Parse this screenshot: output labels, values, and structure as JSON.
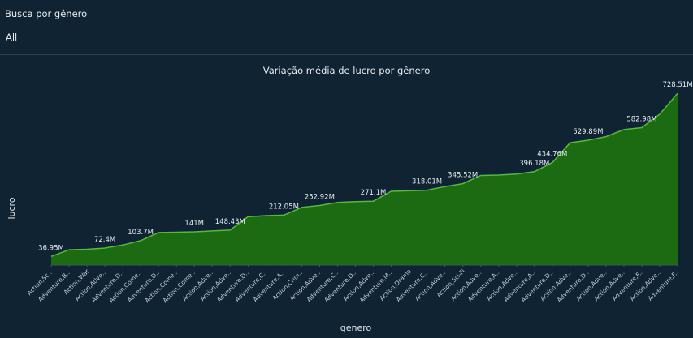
{
  "filter": {
    "label": "Busca por gênero",
    "value": "All"
  },
  "chart_data": {
    "type": "area",
    "title": "Variação média de lucro por gênero",
    "xlabel": "genero",
    "ylabel": "lucro",
    "ylim": [
      0,
      750000000
    ],
    "grid": false,
    "colors": {
      "fill": "#1c6b12",
      "line": "#4fbf2c"
    },
    "categories": [
      "Action,Sc...",
      "Adventure,B...",
      "Action,War",
      "Action,Adve...",
      "Adventure,D...",
      "Action,Come...",
      "Adventure,D...",
      "Action,Come...",
      "Action,Come...",
      "Action,Adve...",
      "Action,Adve...",
      "Adventure,D...",
      "Adventure,C...",
      "Adventure,A...",
      "Action,Crim...",
      "Action,Adve...",
      "Adventure,C...",
      "Adventure,D...",
      "Action,Adve...",
      "Adventure,M...",
      "Action,Drama",
      "Adventure,C...",
      "Action,Adve...",
      "Action,Sci-Fi",
      "Action,Adve...",
      "Adventure,A...",
      "Action,Adve...",
      "Adventure,A...",
      "Adventure,D...",
      "Action,Adve...",
      "Adventure,D...",
      "Action,Adve...",
      "Action,Adve...",
      "Adventure,F...",
      "Action,Adve...",
      "Adventure,F..."
    ],
    "values": [
      36950000,
      65000000,
      67000000,
      72400000,
      85000000,
      103700000,
      138000000,
      139500000,
      141000000,
      145000000,
      148430000,
      205000000,
      210000000,
      212050000,
      245000000,
      252920000,
      266000000,
      269000000,
      271100000,
      313000000,
      315000000,
      318010000,
      333000000,
      345520000,
      380000000,
      382000000,
      386000000,
      396180000,
      434760000,
      519000000,
      529890000,
      545000000,
      575000000,
      582980000,
      640000000,
      728510000
    ],
    "data_labels": [
      {
        "index": 0,
        "text": "36.95M"
      },
      {
        "index": 3,
        "text": "72.4M"
      },
      {
        "index": 5,
        "text": "103.7M"
      },
      {
        "index": 8,
        "text": "141M"
      },
      {
        "index": 10,
        "text": "148.43M"
      },
      {
        "index": 13,
        "text": "212.05M"
      },
      {
        "index": 15,
        "text": "252.92M"
      },
      {
        "index": 18,
        "text": "271.1M"
      },
      {
        "index": 21,
        "text": "318.01M"
      },
      {
        "index": 23,
        "text": "345.52M"
      },
      {
        "index": 27,
        "text": "396.18M"
      },
      {
        "index": 28,
        "text": "434.76M"
      },
      {
        "index": 30,
        "text": "529.89M"
      },
      {
        "index": 33,
        "text": "582.98M"
      },
      {
        "index": 35,
        "text": "728.51M"
      }
    ]
  }
}
